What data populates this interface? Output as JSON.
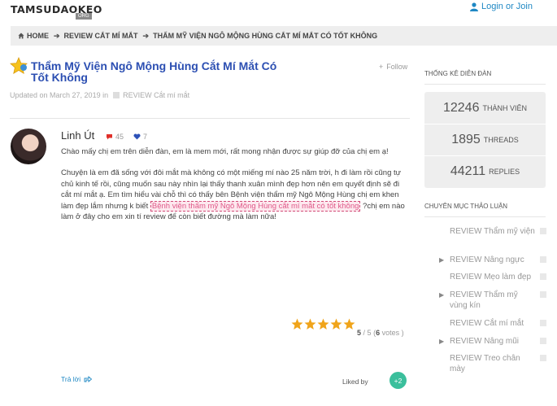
{
  "header": {
    "logo_main": "TAMSUDAOKEO",
    "logo_sub": "ORG",
    "login_label": "Login or Join"
  },
  "breadcrumb": {
    "home": "HOME",
    "items": [
      "REVIEW CẮT MÍ MẮT",
      "THẨM MỸ VIỆN NGÔ MỘNG HÙNG CẮT MÍ MẮT CÓ TỐT KHÔNG"
    ]
  },
  "post": {
    "title": "Thẩm Mỹ Viện Ngô Mộng Hùng Cắt Mí Mắt Có Tốt Không",
    "follow_label": "Follow",
    "updated": "Updated on March 27, 2019 in",
    "category": "REVIEW Cắt mí mắt",
    "author": "Linh Út",
    "comment_count": "45",
    "like_count": "7",
    "greeting": "Chào mấy chị em trên diễn đàn, em là mem mới, rất mong nhận được sự giúp đỡ của chị em ạ!",
    "body_before": "Chuyện là em đã sống với đôi mắt mà không có một miếng mí nào 25 năm trời, h đi làm rồi cũng tự chủ kinh tế rồi, cũng muốn sau này nhìn lại thấy thanh xuân mình đẹp hơn nên em quyết định sẽ đi cắt mí mắt ạ. Em tìm hiểu vài chỗ thì có thấy bên Bệnh viện thẩm mỹ Ngô Mộng Hùng chị em khen làm đẹp lắm nhưng k biết ",
    "body_link": "Bệnh viện thẩm mỹ Ngô Mộng Hùng cắt mí mắt có tốt không",
    "body_after": " ?chị em nào làm ở đây cho em xin tí review để còn biết đường mà làm nữa!",
    "rating_value": "5",
    "rating_max": "/ 5",
    "rating_votes_open": "(",
    "rating_votes": "6",
    "rating_votes_label": "votes )",
    "rating_fraction": 1.0,
    "reply_label": "Trả lời",
    "liked_by_label": "Liked by",
    "liked_badge": "+2"
  },
  "sidebar": {
    "stats_heading": "THỐNG KÊ DIỄN ĐÀN",
    "stats": [
      {
        "num": "12246",
        "label": "THÀNH VIÊN"
      },
      {
        "num": "1895",
        "label": "THREADS"
      },
      {
        "num": "44211",
        "label": "REPLIES"
      }
    ],
    "categories_heading": "CHUYÊN MỤC THẢO LUẬN",
    "categories": [
      {
        "label": "REVIEW Thẩm mỹ viện",
        "has_arrow": false
      },
      {
        "label": "REVIEW Nâng ngực",
        "has_arrow": true
      },
      {
        "label": "REVIEW Mẹo làm đẹp",
        "has_arrow": false
      },
      {
        "label": "REVIEW Thẩm mỹ vùng kín",
        "has_arrow": true
      },
      {
        "label": "REVIEW Cắt mí mắt",
        "has_arrow": false
      },
      {
        "label": "REVIEW Nâng mũi",
        "has_arrow": true
      },
      {
        "label": "REVIEW Treo chân mày",
        "has_arrow": false
      }
    ]
  },
  "colors": {
    "link": "#1f88c4",
    "title": "#2c4fb2",
    "star": "#f0a41a",
    "badge": "#3bbf9c",
    "highlight": "#e05a8a"
  }
}
